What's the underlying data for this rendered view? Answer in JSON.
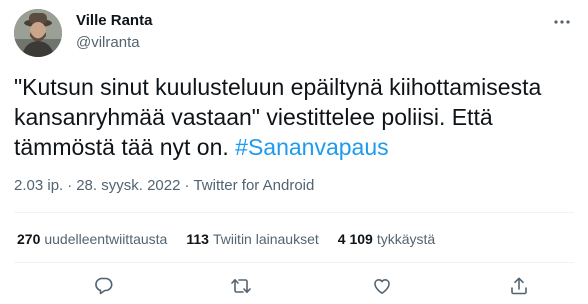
{
  "author": {
    "name": "Ville Ranta",
    "handle": "@vilranta"
  },
  "tweet": {
    "text": "\"Kutsun sinut kuulusteluun epäiltynä kiihottamisesta\nkansanryhmää vastaan\" viestittelee poliisi. Että\ntämmöstä tää nyt on. ",
    "hashtag": "#Sananvapaus"
  },
  "meta": {
    "time": "2.03 ip.",
    "separator1": "·",
    "date": "28. syysk. 2022",
    "separator2": "·",
    "source": "Twitter for Android"
  },
  "stats": {
    "retweets": {
      "count": "270",
      "label": "uudelleentwiittausta"
    },
    "quotes": {
      "count": "113",
      "label": "Twiitin lainaukset"
    },
    "likes": {
      "count": "4 109",
      "label": "tykkäystä"
    }
  },
  "actions": [
    "reply-icon",
    "retweet-icon",
    "like-icon",
    "share-icon"
  ],
  "colors": {
    "text": "#0f1419",
    "secondary": "#536471",
    "accent": "#1d9bf0",
    "divider": "#eff3f4"
  }
}
